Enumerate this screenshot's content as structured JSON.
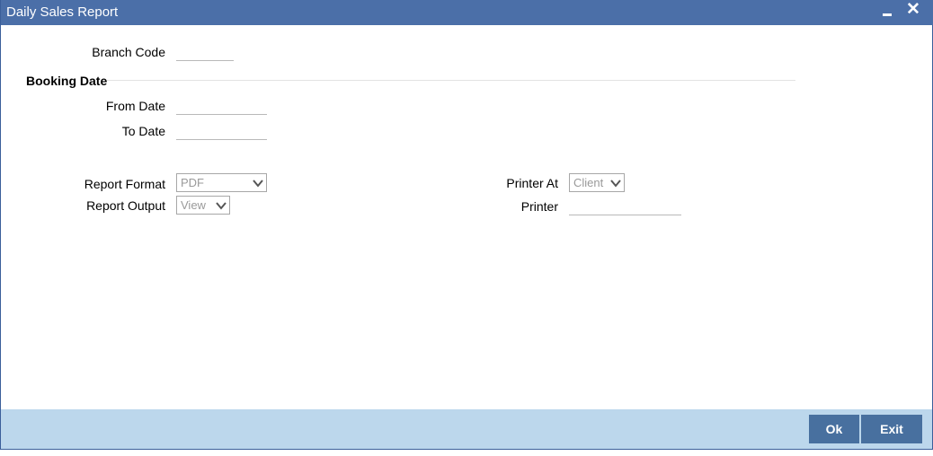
{
  "window": {
    "title": "Daily Sales Report",
    "minimize_icon": "minimize-icon",
    "close_icon": "close-icon"
  },
  "form": {
    "branch_code": {
      "label": "Branch Code",
      "value": ""
    },
    "booking_date": {
      "section_title": "Booking Date",
      "from_date": {
        "label": "From Date",
        "value": ""
      },
      "to_date": {
        "label": "To Date",
        "value": ""
      }
    },
    "report_format": {
      "label": "Report Format",
      "selected": "PDF"
    },
    "report_output": {
      "label": "Report Output",
      "selected": "View"
    },
    "printer_at": {
      "label": "Printer At",
      "selected": "Client"
    },
    "printer": {
      "label": "Printer",
      "value": ""
    }
  },
  "footer": {
    "ok_label": "Ok",
    "exit_label": "Exit"
  },
  "colors": {
    "titlebar": "#4b6fa8",
    "footer": "#bcd7ec",
    "button": "#48709f"
  }
}
